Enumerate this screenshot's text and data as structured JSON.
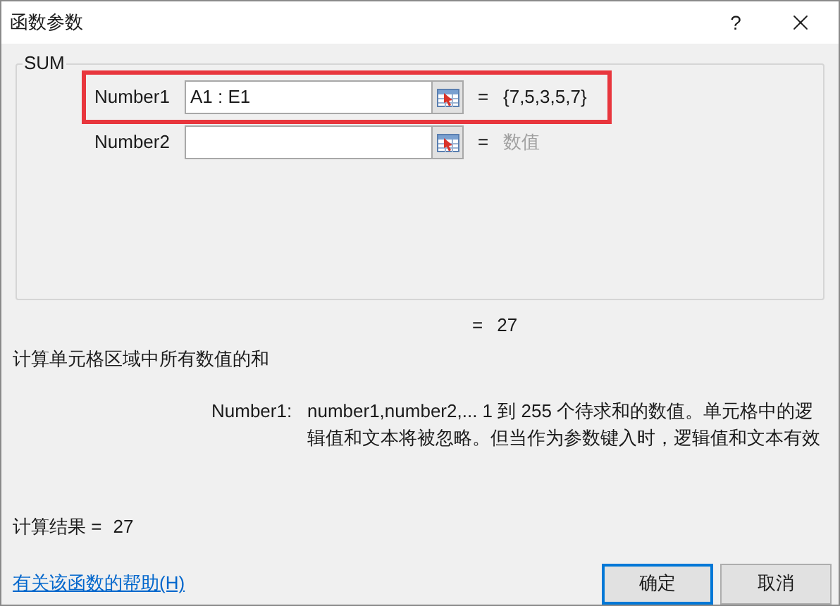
{
  "window": {
    "title": "函数参数",
    "help_glyph": "?"
  },
  "group": {
    "legend": "SUM",
    "arguments": [
      {
        "label": "Number1",
        "value": "A1 : E1",
        "equals": "=",
        "result": "{7,5,3,5,7}",
        "evaluated": true,
        "highlighted": true
      },
      {
        "label": "Number2",
        "equals": "=",
        "result": "数值",
        "evaluated": false,
        "highlighted": false
      }
    ]
  },
  "total": {
    "equals": "=",
    "value": "27"
  },
  "description": "计算单元格区域中所有数值的和",
  "argument_help": {
    "label": "Number1:",
    "text": "number1,number2,...  1 到 255 个待求和的数值。单元格中的逻辑值和文本将被忽略。但当作为参数键入时，逻辑值和文本有效"
  },
  "formula_result": {
    "label": "计算结果 =",
    "value": "27"
  },
  "help_link": "有关该函数的帮助(H)",
  "buttons": [
    {
      "label": "确定",
      "selected": true
    },
    {
      "label": "取消",
      "selected": false
    }
  ]
}
